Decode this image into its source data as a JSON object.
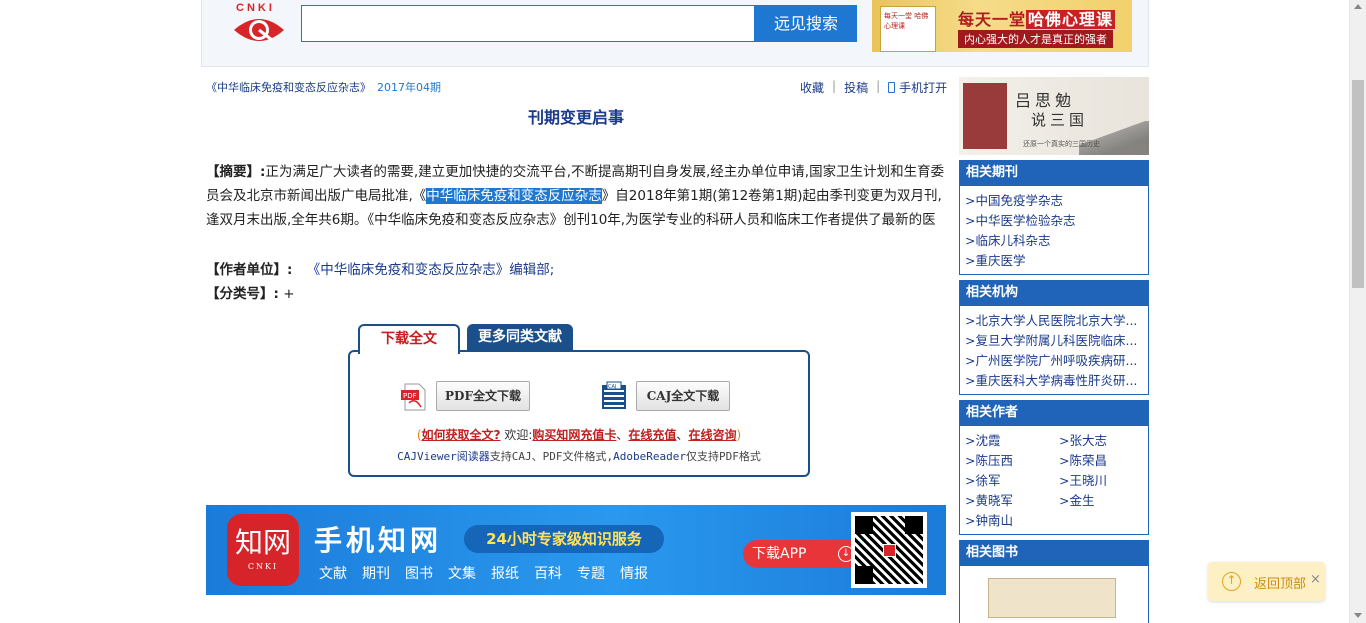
{
  "header": {
    "logo_text": "CNKI",
    "search_placeholder": "",
    "search_button": "远见搜索",
    "ad": {
      "book_text": "每天一堂 哈佛心理课",
      "title_prefix": "每天一堂",
      "title_highlight": "哈佛心理课",
      "subtitle": "内心强大的人才是真正的强者"
    }
  },
  "journal": {
    "name": "《中华临床免疫和变态反应杂志》",
    "issue": "2017年04期"
  },
  "actions": {
    "favorite": "收藏",
    "submit": "投稿",
    "mobile": "手机打开"
  },
  "article": {
    "title": "刊期变更启事",
    "abstract_label": "【摘要】:",
    "abstract_part1": "正为满足广大读者的需要,建立更加快捷的交流平台,不断提高期刊自身发展,经主办单位申请,国家卫生计划和生育委员会及北京市新闻出版广电局批准,《",
    "abstract_selected": "中华临床免疫和变态反应杂志",
    "abstract_part2": "》自2018年第1期(第12卷第1期)起由季刊变更为双月刊,逢双月末出版,全年共6期。《中华临床免疫和变态反应杂志》创刊10年,为医学专业的科研人员和临床工作者提供了最新的医",
    "author_unit_label": "【作者单位】:",
    "author_unit": "《中华临床免疫和变态反应杂志》编辑部;",
    "class_label": "【分类号】:",
    "class_value": "+"
  },
  "download": {
    "tab_download": "下载全文",
    "tab_more": "更多同类文献",
    "pdf_button": "PDF全文下载",
    "caj_button": "CAJ全文下载",
    "paren_open": "(",
    "how_to": "如何获取全文?",
    "welcome": "欢迎:",
    "buy_card": "购买知网充值卡",
    "online_recharge": "在线充值",
    "online_consult": "在线咨询",
    "sep": "、",
    "paren_close": ")",
    "reader_caj": "CAJViewer阅读器",
    "reader_caj_support": "支持CAJ、PDF文件格式,",
    "reader_adobe": "AdobeReader",
    "reader_adobe_support": "仅支持PDF格式"
  },
  "banner": {
    "logo_big": "知网",
    "logo_small": "CNKI",
    "title": "手机知网",
    "slogan": "24小时专家级知识服务",
    "nav": [
      "文献",
      "期刊",
      "图书",
      "文集",
      "报纸",
      "百科",
      "专题",
      "情报"
    ],
    "download_app": "下载APP"
  },
  "sidebar": {
    "ad": {
      "title1": "吕思勉",
      "title2": "说三国",
      "subtitle": "还原一个真实的三国历史"
    },
    "related_journals": {
      "title": "相关期刊",
      "items": [
        ">中国免疫学杂志",
        ">中华医学检验杂志",
        ">临床儿科杂志",
        ">重庆医学"
      ]
    },
    "related_institutions": {
      "title": "相关机构",
      "items": [
        ">北京大学人民医院北京大学...",
        ">复旦大学附属儿科医院临床...",
        ">广州医学院广州呼吸疾病研...",
        ">重庆医科大学病毒性肝炎研..."
      ]
    },
    "related_authors": {
      "title": "相关作者",
      "items": [
        ">沈霞",
        ">张大志",
        ">陈压西",
        ">陈荣昌",
        ">徐军",
        ">王晓川",
        ">黄晓军",
        ">金生",
        ">钟南山"
      ]
    },
    "related_books": {
      "title": "相关图书"
    }
  },
  "back_to_top": {
    "label": "返回顶部",
    "close": "×"
  },
  "colors": {
    "accent": "#1e78d2",
    "panel": "#1f64b8",
    "link": "#1a3a8a",
    "red": "#c0211f"
  }
}
